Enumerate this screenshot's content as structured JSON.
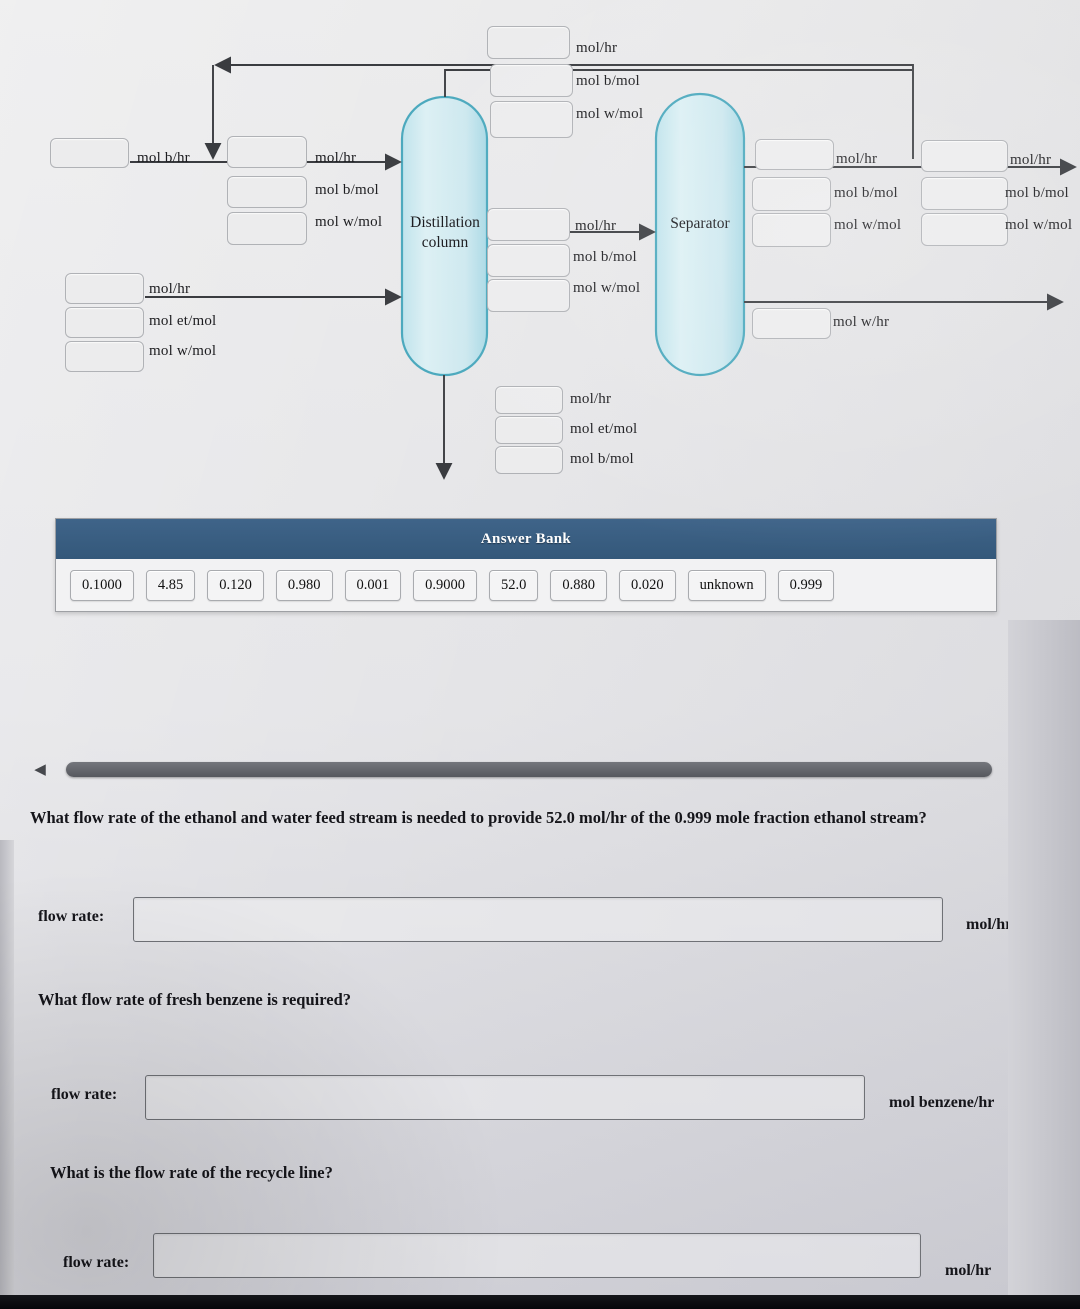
{
  "diagram": {
    "units": [
      {
        "name": "Distillation column",
        "lines": [
          "Distillation",
          "column"
        ]
      },
      {
        "name": "Separator",
        "lines": [
          "Separator"
        ]
      }
    ],
    "streams": {
      "fresh_benzene": {
        "units": [
          "mol b/hr"
        ]
      },
      "column_feed": {
        "units": [
          "mol/hr",
          "mol b/mol",
          "mol w/mol"
        ]
      },
      "ethanol_water_feed": {
        "units": [
          "mol/hr",
          "mol et/mol",
          "mol w/mol"
        ]
      },
      "column_top": {
        "units": [
          "mol/hr",
          "mol b/mol",
          "mol w/mol"
        ]
      },
      "column_side": {
        "units": [
          "mol/hr",
          "mol b/mol",
          "mol w/mol"
        ]
      },
      "column_bottom": {
        "units": [
          "mol/hr",
          "mol et/mol",
          "mol b/mol"
        ]
      },
      "separator_out_left": {
        "units": [
          "mol/hr",
          "mol b/mol",
          "mol w/mol"
        ]
      },
      "separator_out_right": {
        "units": [
          "mol/hr",
          "mol b/mol",
          "mol w/mol"
        ]
      },
      "water_out": {
        "units": [
          "mol w/hr"
        ]
      }
    }
  },
  "answer_bank": {
    "title": "Answer Bank",
    "chips": [
      "0.1000",
      "4.85",
      "0.120",
      "0.980",
      "0.001",
      "0.9000",
      "52.0",
      "0.880",
      "0.020",
      "unknown",
      "0.999"
    ]
  },
  "scrollbar": {
    "left_arrow": "◀",
    "right_arrow": "▶"
  },
  "questions": [
    {
      "prompt": "What flow rate of the ethanol and water feed stream is needed to provide 52.0 mol/hr of the 0.999 mole fraction ethanol stream?",
      "label": "flow rate:",
      "value": "",
      "unit": "mol/hr"
    },
    {
      "prompt": "What flow rate of fresh benzene is required?",
      "label": "flow rate:",
      "value": "",
      "unit": "mol benzene/hr"
    },
    {
      "prompt": "What is the flow rate of the recycle line?",
      "label": "flow rate:",
      "value": "",
      "unit": "mol/hr"
    }
  ],
  "colors": {
    "vessel_fill": "#cfe9ef",
    "vessel_border": "#4aa8bd",
    "bank_header": "#3a5f82",
    "line": "#3a3c40"
  }
}
